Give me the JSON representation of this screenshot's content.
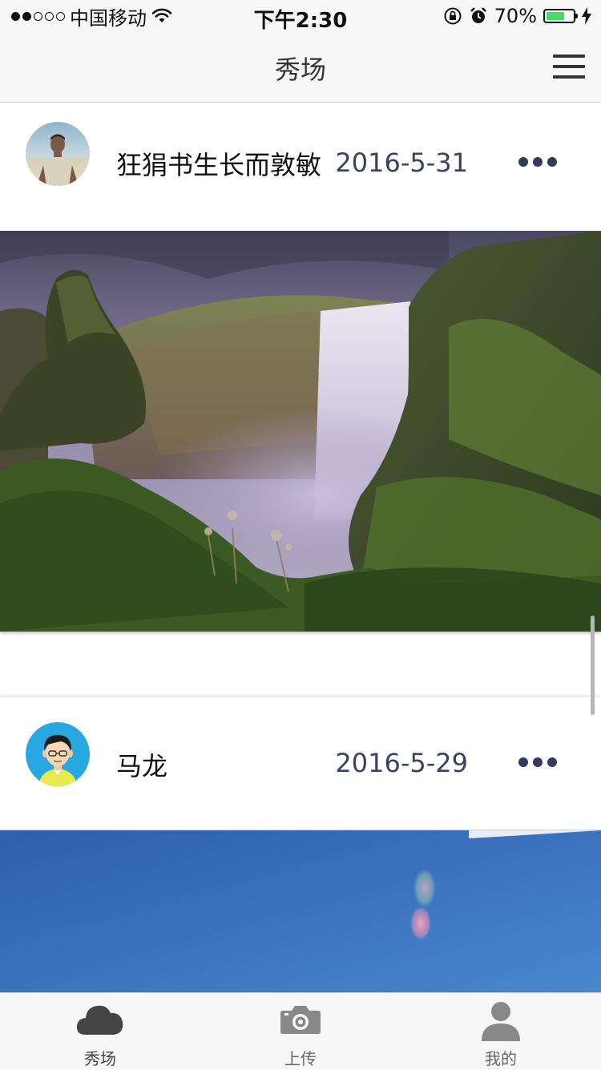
{
  "status_bar": {
    "carrier": "中国移动",
    "time": "下午2:30",
    "battery_percent": "70%",
    "battery_level": 0.7
  },
  "nav": {
    "title": "秀场",
    "menu_icon": "hamburger-menu-icon"
  },
  "posts": [
    {
      "user": "狂狷书生长而敦敏",
      "date": "2016-5-31",
      "avatar": "photo-avatar",
      "image": "waterfall-landscape-photo"
    },
    {
      "user": "马龙",
      "date": "2016-5-29",
      "avatar": "cartoon-avatar",
      "image": "blue-sky-photo"
    }
  ],
  "tabs": [
    {
      "label": "秀场",
      "icon": "cloud-icon",
      "active": true
    },
    {
      "label": "上传",
      "icon": "camera-icon",
      "active": false
    },
    {
      "label": "我的",
      "icon": "user-icon",
      "active": false
    }
  ],
  "colors": {
    "bar_background": "#f7f7f7",
    "date_text": "#3b4260",
    "battery_fill": "#4cd964",
    "tab_icon_active": "#444444",
    "tab_icon_inactive": "#888888"
  }
}
